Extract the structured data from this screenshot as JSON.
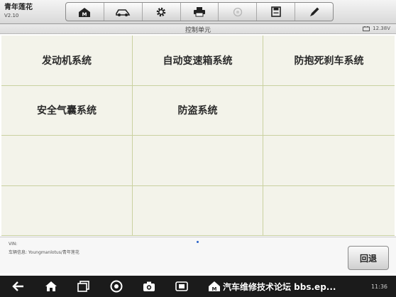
{
  "app": {
    "title": "青年莲花",
    "version": "V2.10"
  },
  "toolbar": {
    "buttons": [
      {
        "icon": "home-icon"
      },
      {
        "icon": "vehicle-icon"
      },
      {
        "icon": "gear-icon"
      },
      {
        "icon": "printer-icon"
      },
      {
        "icon": "help-icon"
      },
      {
        "icon": "save-icon"
      },
      {
        "icon": "pen-icon"
      }
    ]
  },
  "header": {
    "title": "控制单元",
    "voltage": "12.38V"
  },
  "systems": [
    "发动机系统",
    "自动变速箱系统",
    "防抱死刹车系统",
    "安全气囊系统",
    "防盗系统",
    "",
    "",
    "",
    "",
    "",
    "",
    ""
  ],
  "info": {
    "vin_label": "VIN:",
    "vehicle_info": "车辆信息: Youngmanlotus/青年莲花"
  },
  "back_button": "回退",
  "watermark": "汽车维修技术论坛 bbs.ep...",
  "clock": "11:36"
}
